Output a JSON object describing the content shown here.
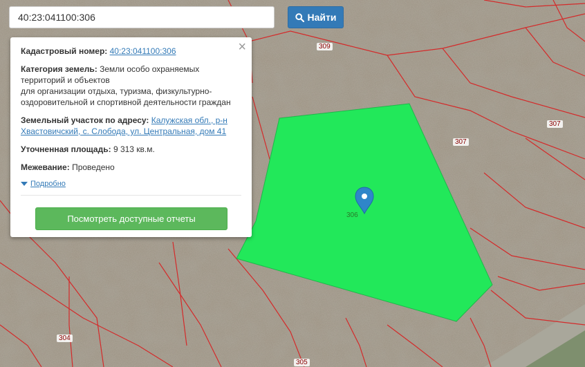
{
  "search": {
    "query": "40:23:041100:306",
    "button_label": "Найти"
  },
  "map": {
    "parcel_labels": [
      "309",
      "307",
      "307",
      "306",
      "304",
      "305"
    ],
    "parcel_color": "#22e85a",
    "boundary_color": "#d42a2a"
  },
  "popup": {
    "close_glyph": "×",
    "cadastral_label": "Кадастровый номер:",
    "cadastral_value": "40:23:041100:306",
    "category_label": "Категория земель:",
    "category_value_1": "Земли особо охраняемых",
    "category_value_2": "территорий и объектов",
    "category_value_3": "для организации отдыха, туризма, физкультурно-",
    "category_value_4": "оздоровительной и спортивной деятельности граждан",
    "address_label": "Земельный участок по адресу:",
    "address_value_1": "Калужская обл., р-н",
    "address_value_2": "Хвастовичский, с. Слобода, ул. Центральная, дом 41",
    "area_label": "Уточненная площадь:",
    "area_value": "9 313 кв.м.",
    "survey_label": "Межевание:",
    "survey_value": "Проведено",
    "more_label": "Подробно",
    "reports_button": "Посмотреть доступные отчеты"
  }
}
